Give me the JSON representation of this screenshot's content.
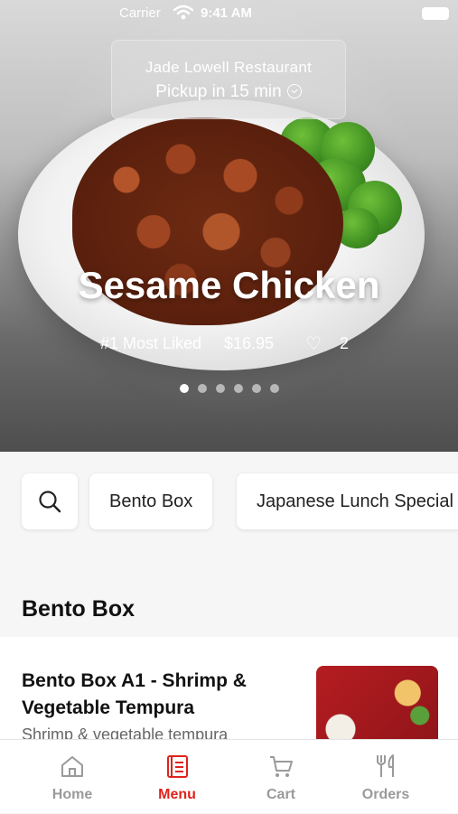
{
  "status_bar": {
    "carrier": "Carrier",
    "time": "9:41 AM"
  },
  "restaurant": {
    "name": "Jade Lowell Restaurant",
    "pickup": "Pickup in 15 min"
  },
  "featured": {
    "title": "Sesame Chicken",
    "badge": "#1 Most Liked",
    "price": "$16.95",
    "likes": "2",
    "page_count": 6,
    "active_page": 1
  },
  "categories": [
    "Bento Box",
    "Japanese Lunch Special"
  ],
  "section": {
    "title": "Bento Box"
  },
  "menu_item": {
    "name": "Bento Box A1 - Shrimp & Vegetable Tempura",
    "description": "Shrimp & vegetable tempura"
  },
  "tabs": [
    {
      "label": "Home",
      "icon": "home-icon"
    },
    {
      "label": "Menu",
      "icon": "menu-icon"
    },
    {
      "label": "Cart",
      "icon": "cart-icon"
    },
    {
      "label": "Orders",
      "icon": "utensils-icon"
    }
  ],
  "colors": {
    "accent": "#e0221c",
    "inactive_tab": "#9a9a9a"
  }
}
